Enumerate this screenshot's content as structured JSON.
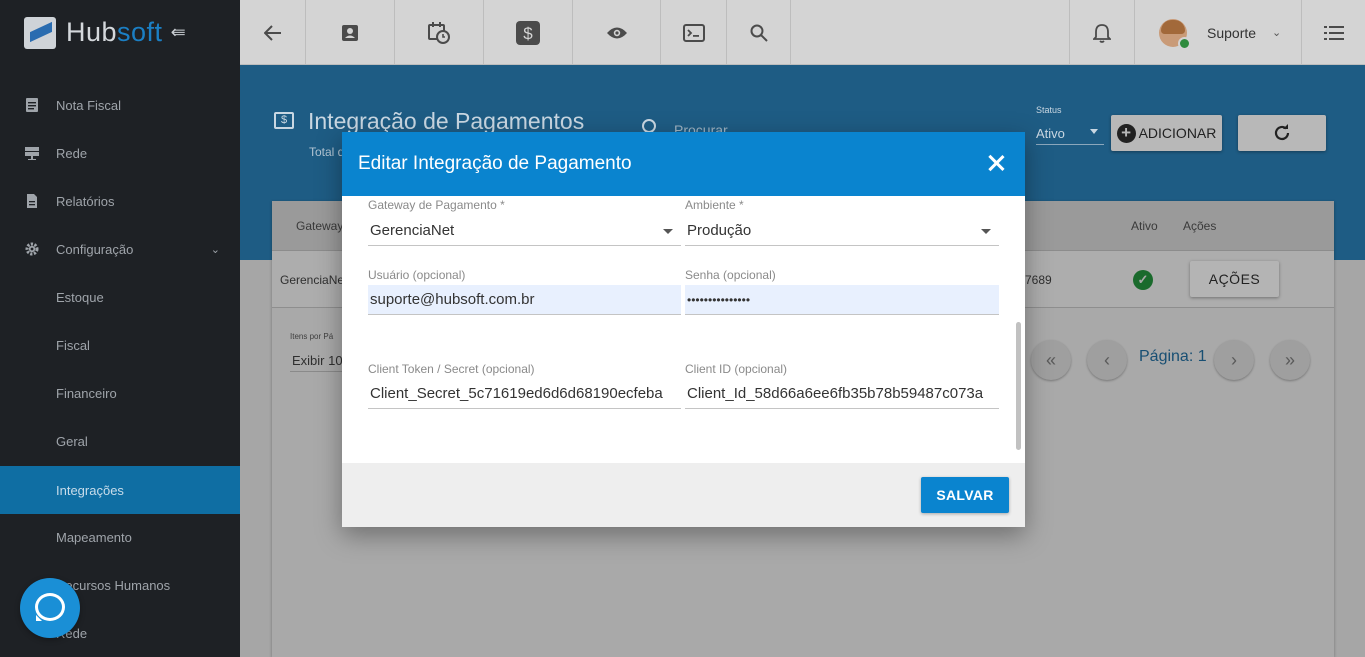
{
  "brand": {
    "hub": "Hub",
    "soft": "soft"
  },
  "sidebar": {
    "items": [
      {
        "label": "Nota Fiscal",
        "icon": "document-icon"
      },
      {
        "label": "Rede",
        "icon": "network-icon"
      },
      {
        "label": "Relatórios",
        "icon": "report-icon"
      },
      {
        "label": "Configuração",
        "icon": "gear-icon"
      },
      {
        "label": "Estoque"
      },
      {
        "label": "Fiscal"
      },
      {
        "label": "Financeiro"
      },
      {
        "label": "Geral"
      },
      {
        "label": "Integrações",
        "active": true
      },
      {
        "label": "Mapeamento"
      },
      {
        "label": "Recursos Humanos"
      },
      {
        "label": "Rede"
      }
    ]
  },
  "topbar": {
    "user_name": "Suporte",
    "icons": [
      "back-arrow-icon",
      "contact-card-icon",
      "calendar-clock-icon",
      "dollar-icon",
      "eye-icon",
      "terminal-icon",
      "search-icon",
      "bell-icon",
      "list-menu-icon"
    ]
  },
  "page": {
    "title": "Integração de Pagamentos",
    "total_label": "Total d",
    "search_placeholder": "Procurar",
    "status_label": "Status",
    "status_value": "Ativo",
    "add_button": "ADICIONAR"
  },
  "table": {
    "headers": {
      "gateway": "Gateway",
      "ativo": "Ativo",
      "acoes": "Ações"
    },
    "row": {
      "gateway": "GerenciaNe",
      "id_tail": "7689",
      "acoes_button": "AÇÕES"
    },
    "items_per_page_label": "Itens por Pá",
    "items_per_page_value": "Exibir 10",
    "page_label": "Página: 1"
  },
  "modal": {
    "title": "Editar Integração de Pagamento",
    "fields": {
      "gateway_label": "Gateway de Pagamento *",
      "gateway_value": "GerenciaNet",
      "ambiente_label": "Ambiente *",
      "ambiente_value": "Produção",
      "usuario_label": "Usuário (opcional)",
      "usuario_value": "suporte@hubsoft.com.br",
      "senha_label": "Senha (opcional)",
      "senha_value": "•••••••••••••••",
      "client_token_label": "Client Token / Secret (opcional)",
      "client_token_value": "Client_Secret_5c71619ed6d6d68190ecfeba",
      "client_id_label": "Client ID (opcional)",
      "client_id_value": "Client_Id_58d66a6ee6fb35b78b59487c073a"
    },
    "save_button": "SALVAR"
  },
  "colors": {
    "accent": "#0a84cf",
    "sidebar": "#1e2125",
    "active_item": "#0f6ea3"
  }
}
